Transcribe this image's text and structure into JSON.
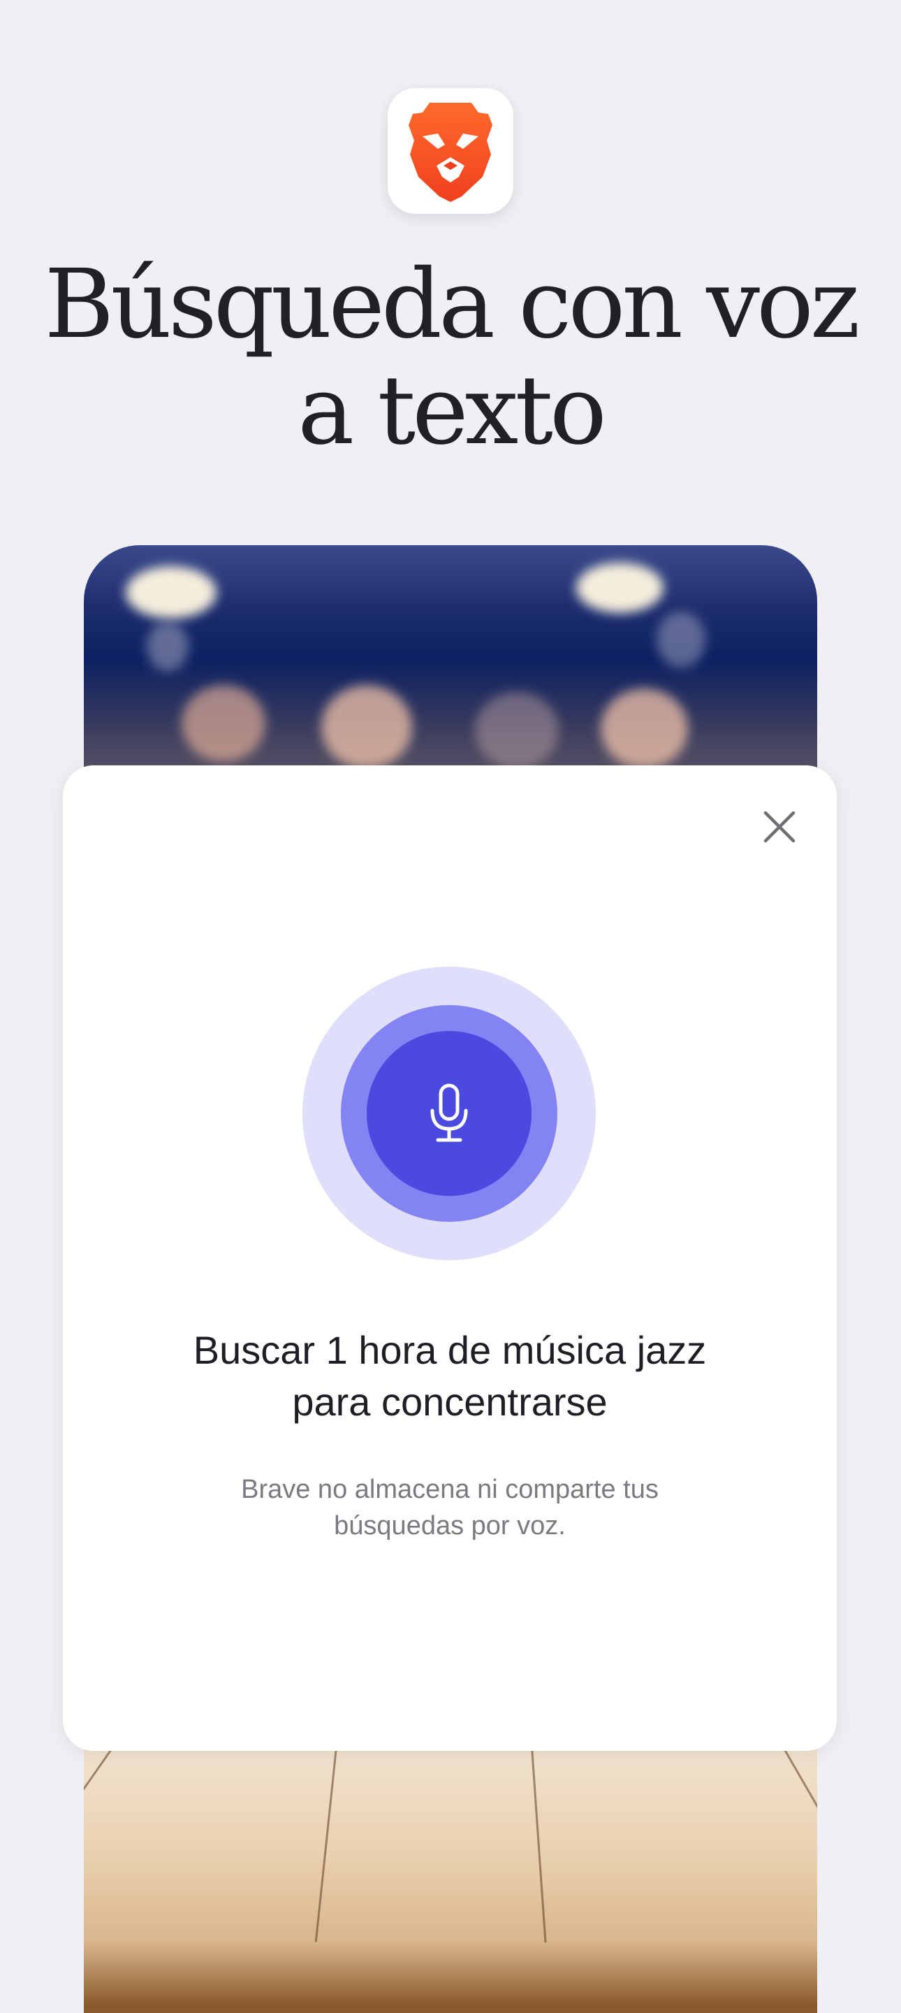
{
  "headline": {
    "line1": "Búsqueda con voz",
    "line2": "a texto"
  },
  "app_icon": {
    "name": "brave-lion-icon",
    "color": "#fb542b"
  },
  "voice_modal": {
    "close_icon": "close-icon",
    "mic_icon": "microphone-icon",
    "query_line1": "Buscar 1 hora de música jazz",
    "query_line2": "para concentrarse",
    "privacy_note": "Brave no almacena ni comparte tus búsquedas por voz."
  },
  "colors": {
    "background": "#efeff4",
    "mic_outer": "#dfdffb",
    "mic_mid": "#8383f4",
    "mic_core": "#4b49e0",
    "brand": "#fb542b"
  }
}
